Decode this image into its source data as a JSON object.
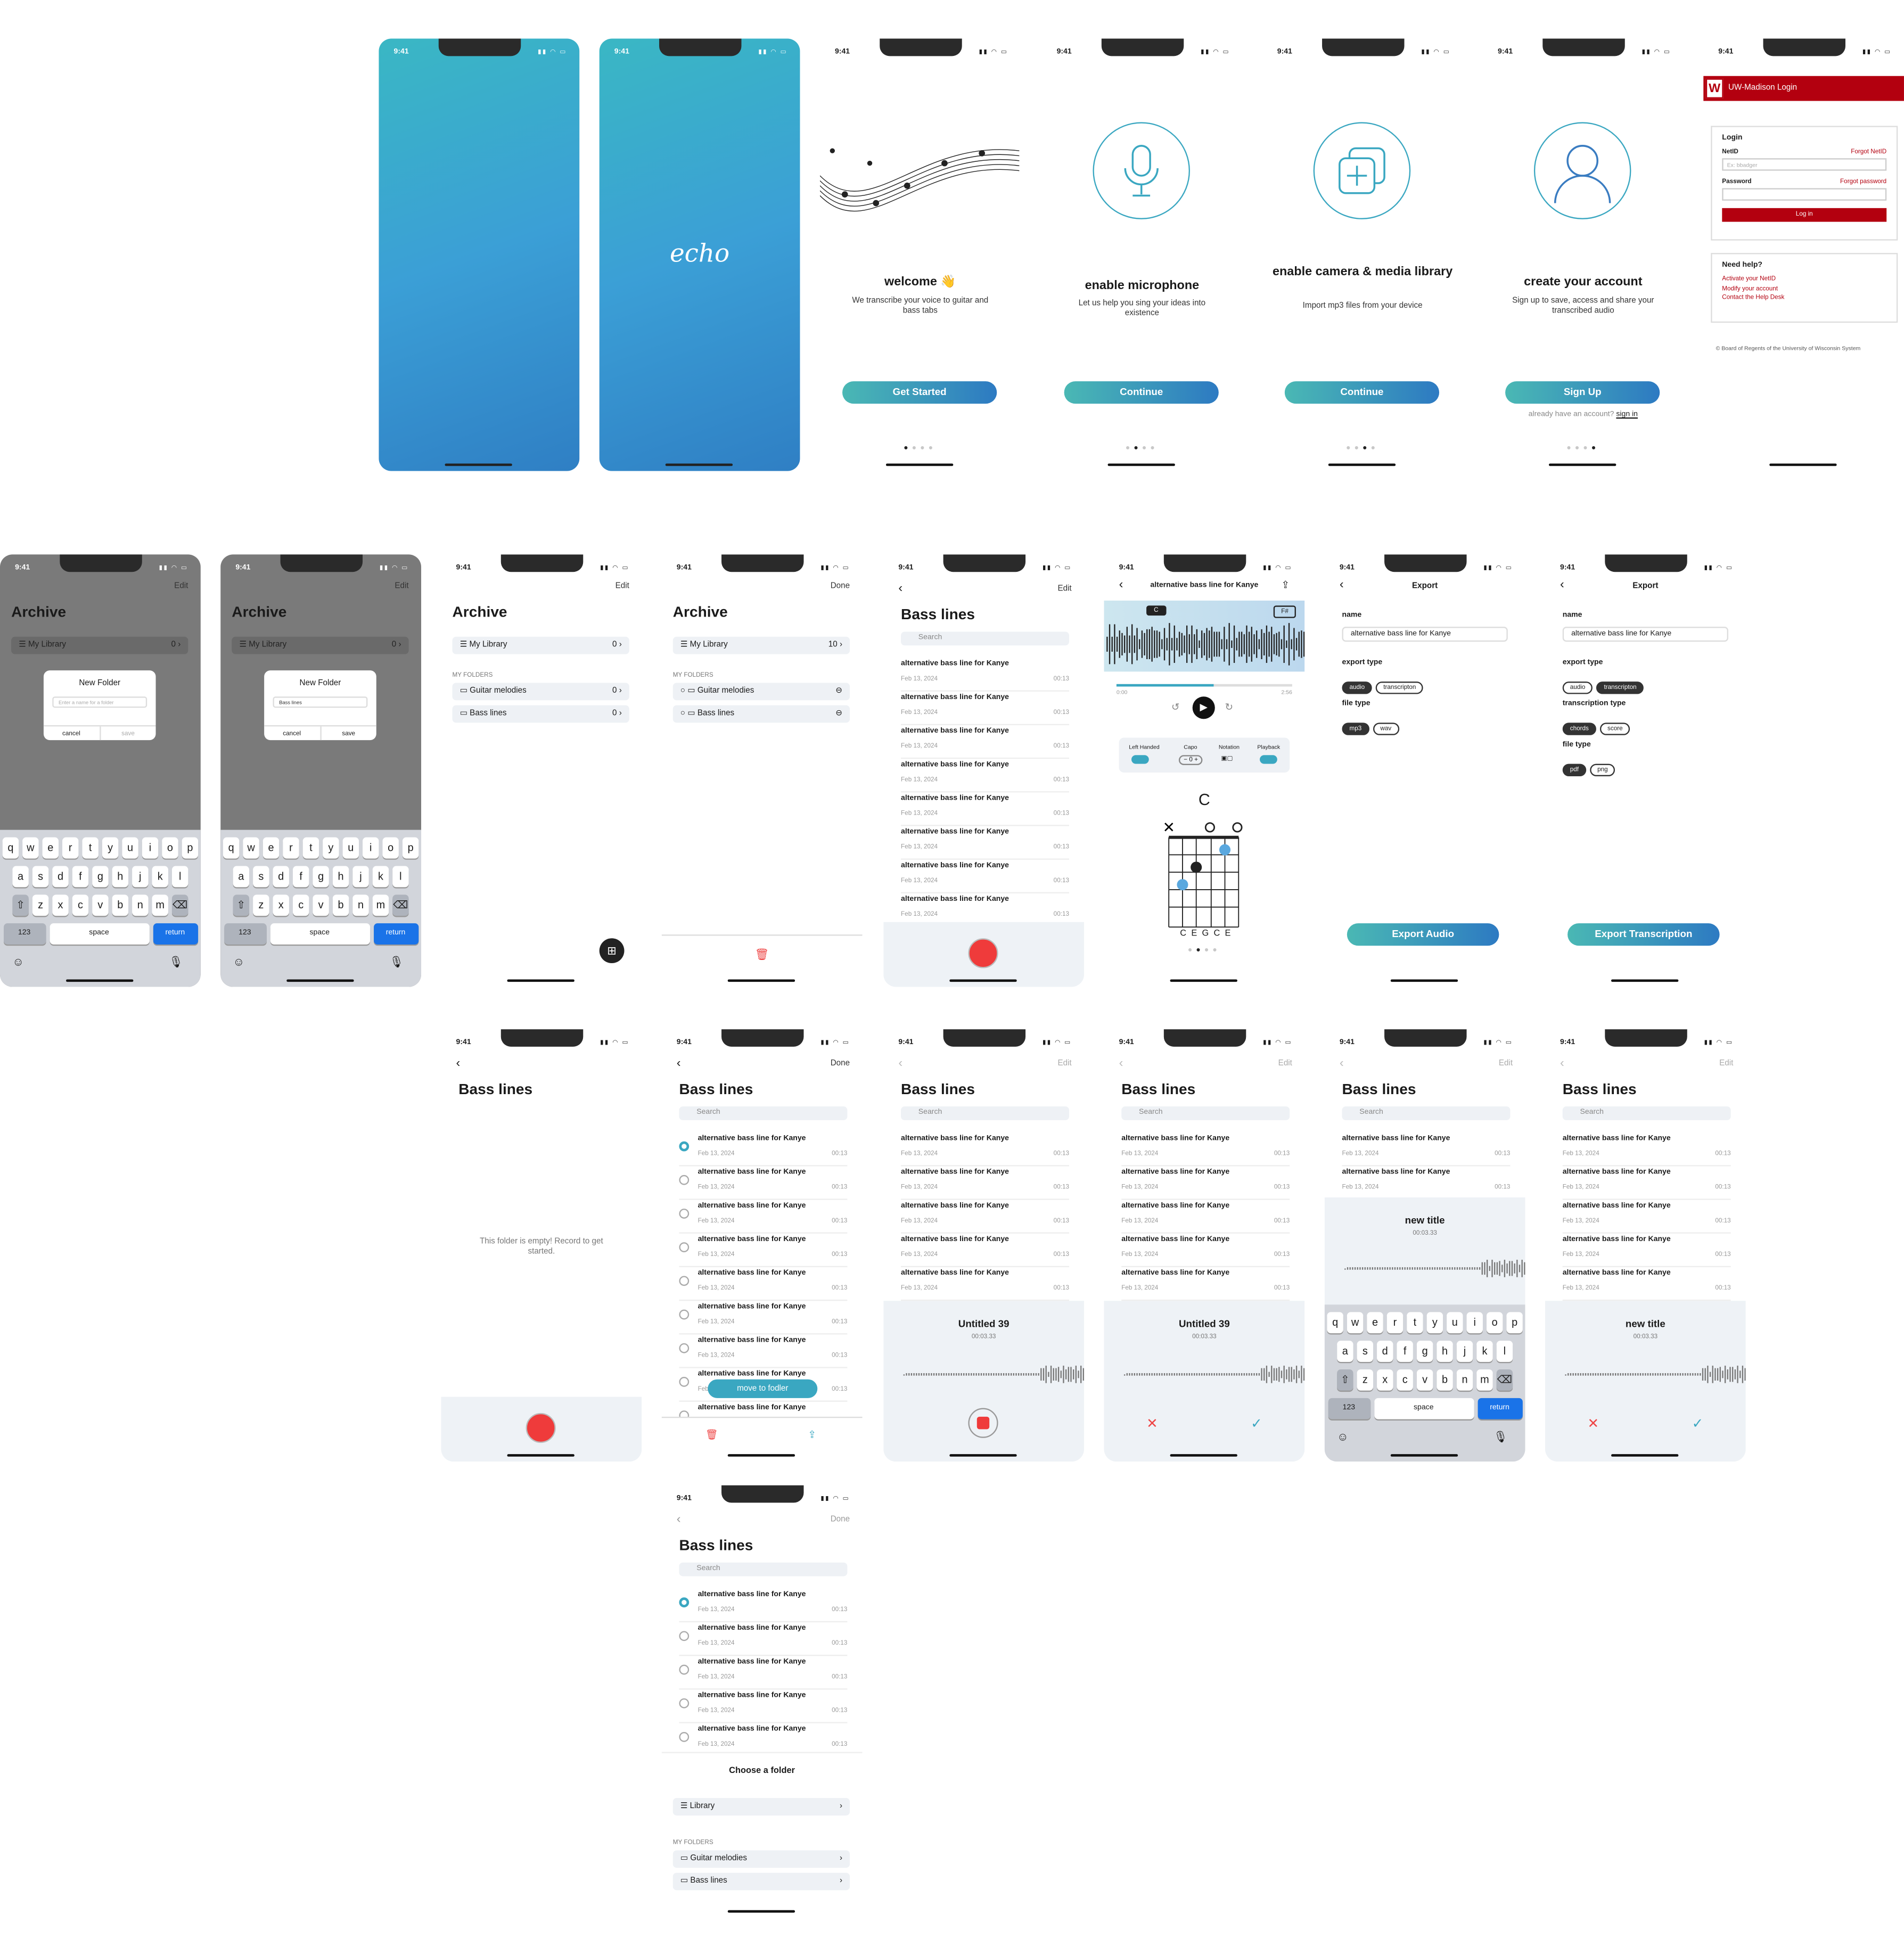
{
  "status_time": "9:41",
  "logo": "echo",
  "onboarding": [
    {
      "title": "welcome 👋",
      "sub": "We transcribe your voice to guitar and bass tabs",
      "button": "Get Started",
      "icon": "music-notes-icon"
    },
    {
      "title": "enable microphone",
      "sub": "Let us help you sing your ideas into existence",
      "button": "Continue",
      "icon": "microphone-icon"
    },
    {
      "title": "enable camera & media library",
      "sub": "Import mp3 files from your device",
      "button": "Continue",
      "icon": "media-library-icon"
    },
    {
      "title": "create your account",
      "sub": "Sign up to save, access and share your transcribed audio",
      "button": "Sign Up",
      "icon": "user-icon",
      "signin_prefix": "already have an account?",
      "signin_link": "sign in"
    }
  ],
  "uw": {
    "bar": "UW-Madison Login",
    "login_heading": "Login",
    "netid_label": "NetID",
    "forgot_netid": "Forgot NetID",
    "netid_placeholder": "Ex: bbadger",
    "password_label": "Password",
    "forgot_password": "Forgot password",
    "login_button": "Log in",
    "help_heading": "Need help?",
    "help_links": [
      "Activate your NetID",
      "Modify your account",
      "Contact the Help Desk"
    ],
    "footer": "© Board of Regents of the University of Wisconsin System"
  },
  "archive": {
    "title": "Archive",
    "edit": "Edit",
    "done": "Done",
    "library": "My Library",
    "library_count": "0",
    "library_count_edit": "10",
    "folders_label": "MY FOLDERS",
    "folders": [
      {
        "name": "Guitar melodies",
        "count": "0"
      },
      {
        "name": "Bass lines",
        "count": "0"
      }
    ]
  },
  "new_folder": {
    "title": "New Folder",
    "placeholder": "Enter a name for a folder",
    "typed": "Bass lines",
    "cancel": "cancel",
    "save": "save"
  },
  "keyboard": {
    "row1": [
      "q",
      "w",
      "e",
      "r",
      "t",
      "y",
      "u",
      "i",
      "o",
      "p"
    ],
    "row2": [
      "a",
      "s",
      "d",
      "f",
      "g",
      "h",
      "j",
      "k",
      "l"
    ],
    "row3": [
      "z",
      "x",
      "c",
      "v",
      "b",
      "n",
      "m"
    ],
    "num": "123",
    "space": "space",
    "ret": "return"
  },
  "folder": {
    "title": "Bass lines",
    "search": "Search",
    "empty": "This folder is empty! Record to get started.",
    "item_title": "alternative bass line for Kanye",
    "item_date": "Feb 13, 2024",
    "item_dur": "00:13"
  },
  "recording": {
    "untitled": "Untitled 39",
    "new_title": "new title",
    "time": "00:03.33"
  },
  "move": {
    "toast": "move to fodler",
    "choose": "Choose a folder",
    "library": "Library"
  },
  "player": {
    "title": "alternative bass line for Kanye",
    "chord_name": "C",
    "key_left": "C",
    "key_right": "F#",
    "t_start": "0:00",
    "t_end": "2:56",
    "controls": [
      {
        "label": "Left Handed"
      },
      {
        "label": "Capo",
        "value": "0"
      },
      {
        "label": "Notation"
      },
      {
        "label": "Playback"
      }
    ],
    "strings": "C  E G C  E"
  },
  "export": {
    "title": "Export",
    "name_label": "name",
    "name_value": "alternative bass line for Kanye",
    "type_label": "export type",
    "types": [
      "audio",
      "transcripton"
    ],
    "file_label": "file type",
    "audio_files": [
      "mp3",
      "wav"
    ],
    "trans_label": "transcription type",
    "trans_types": [
      "chords",
      "score"
    ],
    "trans_files": [
      "pdf",
      "png"
    ],
    "btn_audio": "Export Audio",
    "btn_trans": "Export Transcription"
  }
}
